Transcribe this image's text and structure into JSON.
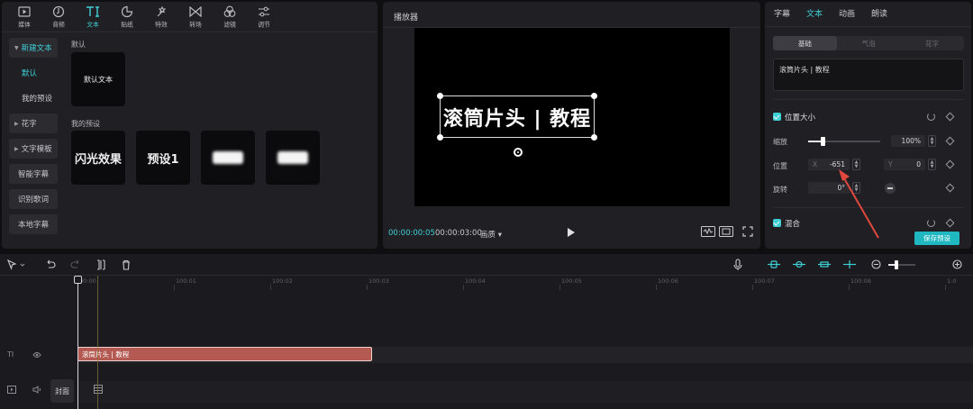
{
  "toolbar_tabs": [
    {
      "label": "媒体",
      "icon": "media-icon"
    },
    {
      "label": "音频",
      "icon": "audio-icon"
    },
    {
      "label": "文本",
      "icon": "text-icon"
    },
    {
      "label": "贴纸",
      "icon": "sticker-icon"
    },
    {
      "label": "特效",
      "icon": "effects-icon"
    },
    {
      "label": "转场",
      "icon": "transition-icon"
    },
    {
      "label": "滤镜",
      "icon": "filter-icon"
    },
    {
      "label": "调节",
      "icon": "adjust-icon"
    }
  ],
  "toolbar_active": "文本",
  "left_nav": {
    "new_text": "新建文本",
    "default": "默认",
    "my_presets": "我的预设",
    "fancy_text": "花字",
    "text_template": "文字模板",
    "smart_caption": "智能字幕",
    "recognize_lyrics": "识别歌词",
    "local_caption": "本地字幕"
  },
  "library": {
    "default_section": "默认",
    "default_card": "默认文本",
    "my_presets_section": "我的预设",
    "preset_cards": [
      "闪光效果",
      "预设1"
    ]
  },
  "player": {
    "title": "播放器",
    "overlay_text": "滚筒片头 | 教程",
    "current_time": "00:00:00:05",
    "total_time": "00:00:03:00",
    "quality": "画质",
    "quality_caret": "▾"
  },
  "inspector": {
    "tabs": [
      "字幕",
      "文本",
      "动画",
      "朗读"
    ],
    "active_tab": "文本",
    "segments": [
      "基础",
      "气泡",
      "花字"
    ],
    "active_segment": "基础",
    "text_value": "滚筒片头 | 教程",
    "position_size": "位置大小",
    "scale_label": "缩放",
    "scale_value": "100%",
    "scale_fraction": 0.2,
    "position_label": "位置",
    "x_key": "X",
    "x_value": "-651",
    "y_key": "Y",
    "y_value": "0",
    "rotate_label": "旋转",
    "rotate_value": "0°",
    "mix_label": "混合",
    "save_preset": "保存预设",
    "stepper_up": "▲",
    "stepper_down": "▼"
  },
  "timeline": {
    "ruler_labels": [
      "00:00",
      "100:01",
      "100:02",
      "100:03",
      "100:04",
      "100:05",
      "100:06",
      "100:07",
      "100:08",
      "1:0"
    ],
    "clip_text": "滚筒片头 | 教程",
    "cover_label": "封面",
    "text_track_glyph": "TI",
    "zoom_fraction": 0.25
  },
  "colors": {
    "accent": "#3fd0d6",
    "clip": "#b45a52",
    "annotation_arrow": "#e0483e"
  }
}
